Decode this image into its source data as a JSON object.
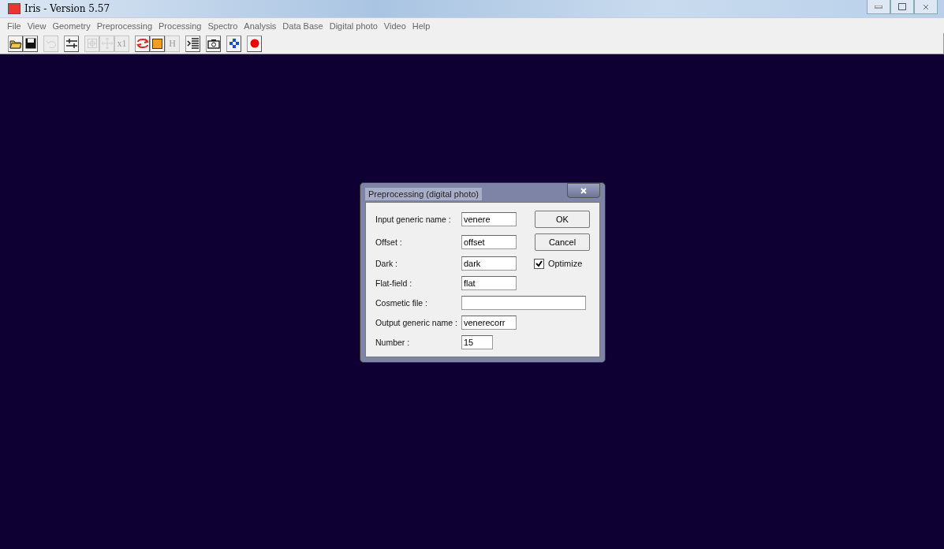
{
  "window": {
    "title": "Iris - Version 5.57"
  },
  "menu": [
    "File",
    "View",
    "Geometry",
    "Preprocessing",
    "Processing",
    "Spectro",
    "Analysis",
    "Data Base",
    "Digital photo",
    "Video",
    "Help"
  ],
  "toolbar": [
    {
      "kind": "open",
      "disabled": false
    },
    {
      "kind": "save",
      "disabled": false
    },
    {
      "kind": "undo",
      "disabled": true
    },
    {
      "kind": "adjust",
      "disabled": false
    },
    {
      "kind": "crosshair",
      "disabled": true
    },
    {
      "kind": "move",
      "disabled": true
    },
    {
      "kind": "text",
      "label": "x1",
      "disabled": true
    },
    {
      "kind": "swirl",
      "disabled": false
    },
    {
      "kind": "square",
      "disabled": false
    },
    {
      "kind": "text",
      "label": "H",
      "disabled": true
    },
    {
      "kind": "list",
      "disabled": false
    },
    {
      "kind": "camera",
      "disabled": false
    },
    {
      "kind": "diamond",
      "disabled": false
    },
    {
      "kind": "dot",
      "disabled": false
    }
  ],
  "dialog": {
    "title": "Preprocessing (digital photo)",
    "fields": [
      {
        "label": "Input generic name :",
        "value": "venere",
        "kind": "name"
      },
      {
        "label": "Offset :",
        "value": "offset",
        "kind": "name"
      },
      {
        "label": "Dark :",
        "value": "dark",
        "kind": "name"
      },
      {
        "label": "Flat-field :",
        "value": "flat",
        "kind": "name"
      },
      {
        "label": "Cosmetic file :",
        "kind": "wide"
      },
      {
        "label": "Output generic name :",
        "value": "venerecorr",
        "kind": "name"
      },
      {
        "label": "Number :",
        "value": "15",
        "kind": "number"
      }
    ],
    "buttons": [
      "OK",
      "Cancel"
    ],
    "optimize": {
      "label": "Optimize",
      "checked": true
    }
  }
}
